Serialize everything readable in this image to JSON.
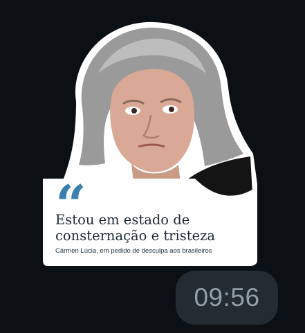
{
  "sticker": {
    "quote_marks": "“",
    "headline_line1": "Estou em estado de",
    "headline_line2": "consternação e tristeza",
    "caption": "Cármen Lúcia, em pedido de desculpa aos brasileiros",
    "accent_color": "#3a7fb0"
  },
  "message": {
    "time": "09:56"
  }
}
